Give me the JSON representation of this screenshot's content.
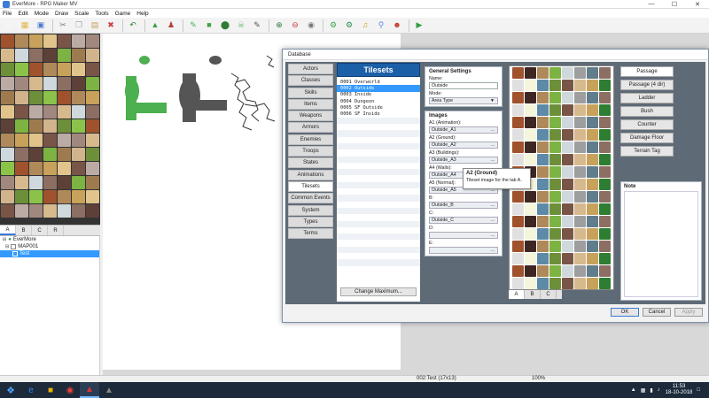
{
  "window": {
    "title": "EverMore - RPG Maker MV"
  },
  "menu": [
    "File",
    "Edit",
    "Mode",
    "Draw",
    "Scale",
    "Tools",
    "Game",
    "Help"
  ],
  "toolbar": [
    {
      "icon": "new-file-icon",
      "color": "#ffffff"
    },
    {
      "icon": "open-folder-icon",
      "color": "#e3b341"
    },
    {
      "icon": "save-icon",
      "color": "#4b7bd1"
    },
    {
      "sep": true
    },
    {
      "icon": "cut-icon",
      "color": "#7a7a7a"
    },
    {
      "icon": "copy-icon",
      "color": "#9ab"
    },
    {
      "icon": "paste-icon",
      "color": "#c9a05a"
    },
    {
      "icon": "delete-icon",
      "color": "#d04040"
    },
    {
      "sep": true
    },
    {
      "icon": "undo-icon",
      "color": "#2f8a3a"
    },
    {
      "sep": true
    },
    {
      "icon": "map-mode-icon",
      "color": "#3f9b4a"
    },
    {
      "icon": "event-mode-icon",
      "color": "#b83a3a"
    },
    {
      "sep": true
    },
    {
      "icon": "pencil-icon",
      "color": "#4caf50"
    },
    {
      "icon": "rectangle-icon",
      "color": "#43a047"
    },
    {
      "icon": "ellipse-icon",
      "color": "#2e7d32"
    },
    {
      "icon": "fill-icon",
      "color": "#66bb6a"
    },
    {
      "icon": "shadow-pen-icon",
      "color": "#555555"
    },
    {
      "sep": true
    },
    {
      "icon": "zoom-in-icon",
      "color": "#2b7a3a"
    },
    {
      "icon": "zoom-out-icon",
      "color": "#c33"
    },
    {
      "icon": "actual-size-icon",
      "color": "#777"
    },
    {
      "sep": true
    },
    {
      "icon": "database-icon",
      "color": "#3fa34d"
    },
    {
      "icon": "plugin-manager-icon",
      "color": "#2e8b57"
    },
    {
      "icon": "sound-test-icon",
      "color": "#d4a017"
    },
    {
      "icon": "event-searcher-icon",
      "color": "#5b8fd9"
    },
    {
      "icon": "character-generator-icon",
      "color": "#c0392b"
    },
    {
      "sep": true
    },
    {
      "icon": "playtest-icon",
      "color": "#2ea043"
    }
  ],
  "palette_tabs": [
    "A",
    "B",
    "C",
    "R"
  ],
  "maptree": {
    "project": "EverMore",
    "map": "MAP001",
    "event": "Test"
  },
  "database": {
    "title": "Database",
    "categories": [
      "Actors",
      "Classes",
      "Skills",
      "Items",
      "Weapons",
      "Armors",
      "Enemies",
      "Troops",
      "States",
      "Animations",
      "Tilesets",
      "Common Events",
      "System",
      "Types",
      "Terms"
    ],
    "active_category": "Tilesets",
    "list_header": "Tilesets",
    "list_items": [
      "0001 Overworld",
      "0002 Outside",
      "0003 Inside",
      "0004 Dungeon",
      "0005 SF Outside",
      "0006 SF Inside"
    ],
    "selected_item": "0002 Outside",
    "change_max_label": "Change Maximum...",
    "general": {
      "header": "General Settings",
      "name_label": "Name:",
      "name_value": "Outside",
      "mode_label": "Mode:",
      "mode_value": "Area Type"
    },
    "images": {
      "header": "Images",
      "slots": [
        {
          "label": "A1 (Animation):",
          "value": "Outside_A1"
        },
        {
          "label": "A2 (Ground):",
          "value": "Outside_A2"
        },
        {
          "label": "A3 (Buildings):",
          "value": "Outside_A3"
        },
        {
          "label": "A4 (Walls):",
          "value": "Outside_A4"
        },
        {
          "label": "A5 (Normal):",
          "value": "Outside_A5"
        },
        {
          "label": "B:",
          "value": "Outside_B"
        },
        {
          "label": "C:",
          "value": "Outside_C"
        },
        {
          "label": "D:",
          "value": ""
        },
        {
          "label": "E:",
          "value": ""
        }
      ]
    },
    "tooltip": {
      "title": "A2 (Ground)",
      "body": "Tileset image for the tab A."
    },
    "tile_tabs": [
      "A",
      "B",
      "C"
    ],
    "flags": [
      "Passage",
      "Passage (4 dir)",
      "Ladder",
      "Bush",
      "Counter",
      "Damage Floor",
      "Terrain Tag"
    ],
    "active_flag": "Passage",
    "note_label": "Note",
    "buttons": {
      "ok": "OK",
      "cancel": "Cancel",
      "apply": "Apply"
    }
  },
  "status": {
    "map_info": "002:Test (17x13)",
    "zoom": "100%"
  },
  "taskbar": {
    "time": "11:53",
    "date": "18-10-2018"
  }
}
